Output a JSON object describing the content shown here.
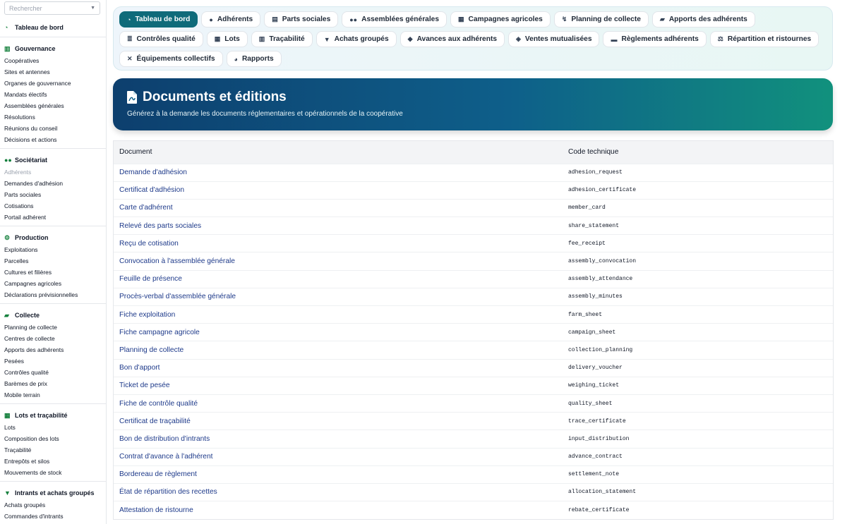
{
  "search": {
    "placeholder": "Rechercher"
  },
  "sidebar": {
    "groups": [
      {
        "title": "Tableau de bord",
        "icon": "dashboard-icon",
        "items": []
      },
      {
        "title": "Gouvernance",
        "icon": "building-icon",
        "items": [
          "Coopératives",
          "Sites et antennes",
          "Organes de gouvernance",
          "Mandats électifs",
          "Assemblées générales",
          "Résolutions",
          "Réunions du conseil",
          "Décisions et actions"
        ]
      },
      {
        "title": "Sociétariat",
        "icon": "users-icon",
        "items": [
          "Adhérents",
          "Demandes d'adhésion",
          "Parts sociales",
          "Cotisations",
          "Portail adhérent"
        ]
      },
      {
        "title": "Production",
        "icon": "tractor-icon",
        "items": [
          "Exploitations",
          "Parcelles",
          "Cultures et filières",
          "Campagnes agricoles",
          "Déclarations prévisionnelles"
        ]
      },
      {
        "title": "Collecte",
        "icon": "truck-icon",
        "items": [
          "Planning de collecte",
          "Centres de collecte",
          "Apports des adhérents",
          "Pesées",
          "Contrôles qualité",
          "Barèmes de prix",
          "Mobile terrain"
        ]
      },
      {
        "title": "Lots et traçabilité",
        "icon": "boxes-icon",
        "items": [
          "Lots",
          "Composition des lots",
          "Traçabilité",
          "Entrepôts et silos",
          "Mouvements de stock"
        ]
      },
      {
        "title": "Intrants et achats groupés",
        "icon": "cart-icon",
        "items": [
          "Achats groupés",
          "Commandes d'intrants"
        ]
      }
    ]
  },
  "nav": [
    {
      "label": "Tableau de bord",
      "icon": "dashboard-icon",
      "active": true
    },
    {
      "label": "Adhérents",
      "icon": "user-icon"
    },
    {
      "label": "Parts sociales",
      "icon": "coins-icon"
    },
    {
      "label": "Assemblées générales",
      "icon": "users-icon"
    },
    {
      "label": "Campagnes agricoles",
      "icon": "calendar-icon"
    },
    {
      "label": "Planning de collecte",
      "icon": "route-icon"
    },
    {
      "label": "Apports des adhérents",
      "icon": "truck-icon"
    },
    {
      "label": "Contrôles qualité",
      "icon": "checklist-icon"
    },
    {
      "label": "Lots",
      "icon": "boxes-icon"
    },
    {
      "label": "Traçabilité",
      "icon": "barcode-icon"
    },
    {
      "label": "Achats groupés",
      "icon": "cart-icon"
    },
    {
      "label": "Avances aux adhérents",
      "icon": "hand-coin-icon"
    },
    {
      "label": "Ventes mutualisées",
      "icon": "scale-icon"
    },
    {
      "label": "Règlements adhérents",
      "icon": "money-icon"
    },
    {
      "label": "Répartition et ristournes",
      "icon": "balance-icon"
    },
    {
      "label": "Équipements collectifs",
      "icon": "tools-icon"
    },
    {
      "label": "Rapports",
      "icon": "pie-chart-icon"
    }
  ],
  "hero": {
    "title": "Documents et éditions",
    "subtitle": "Générez à la demande les documents réglementaires et opérationnels de la coopérative"
  },
  "table": {
    "headers": {
      "document": "Document",
      "code": "Code technique"
    },
    "rows": [
      {
        "document": "Demande d'adhésion",
        "code": "adhesion_request"
      },
      {
        "document": "Certificat d'adhésion",
        "code": "adhesion_certificate"
      },
      {
        "document": "Carte d'adhérent",
        "code": "member_card"
      },
      {
        "document": "Relevé des parts sociales",
        "code": "share_statement"
      },
      {
        "document": "Reçu de cotisation",
        "code": "fee_receipt"
      },
      {
        "document": "Convocation à l'assemblée générale",
        "code": "assembly_convocation"
      },
      {
        "document": "Feuille de présence",
        "code": "assembly_attendance"
      },
      {
        "document": "Procès-verbal d'assemblée générale",
        "code": "assembly_minutes"
      },
      {
        "document": "Fiche exploitation",
        "code": "farm_sheet"
      },
      {
        "document": "Fiche campagne agricole",
        "code": "campaign_sheet"
      },
      {
        "document": "Planning de collecte",
        "code": "collection_planning"
      },
      {
        "document": "Bon d'apport",
        "code": "delivery_voucher"
      },
      {
        "document": "Ticket de pesée",
        "code": "weighing_ticket"
      },
      {
        "document": "Fiche de contrôle qualité",
        "code": "quality_sheet"
      },
      {
        "document": "Certificat de traçabilité",
        "code": "trace_certificate"
      },
      {
        "document": "Bon de distribution d'intrants",
        "code": "input_distribution"
      },
      {
        "document": "Contrat d'avance à l'adhérent",
        "code": "advance_contract"
      },
      {
        "document": "Bordereau de règlement",
        "code": "settlement_note"
      },
      {
        "document": "État de répartition des recettes",
        "code": "allocation_statement"
      },
      {
        "document": "Attestation de ristourne",
        "code": "rebate_certificate"
      }
    ]
  },
  "colors": {
    "accent": "#0f6b7a",
    "sidebar_icon": "#15803d",
    "link": "#1e3a8a"
  }
}
